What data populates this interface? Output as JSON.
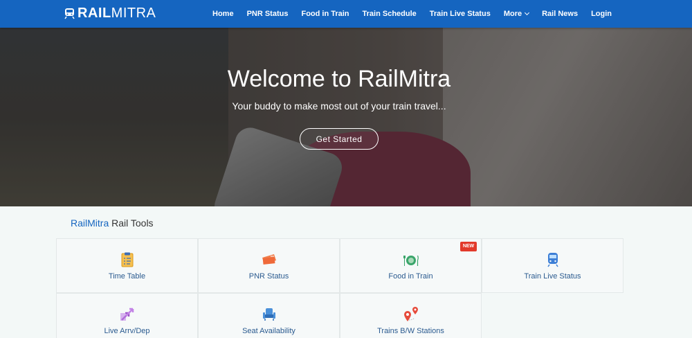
{
  "brand": {
    "bold": "RAIL",
    "light": "MITRA"
  },
  "nav": {
    "items": [
      "Home",
      "PNR Status",
      "Food in Train",
      "Train Schedule",
      "Train Live Status",
      "More",
      "Rail News",
      "Login"
    ]
  },
  "hero": {
    "title": "Welcome to RailMitra",
    "subtitle": "Your buddy to make most out of your train travel...",
    "cta": "Get Started"
  },
  "tools": {
    "brand": "RailMitra",
    "rest": " Rail Tools",
    "items": [
      {
        "label": "Time Table",
        "icon": "clipboard-icon"
      },
      {
        "label": "PNR Status",
        "icon": "ticket-icon"
      },
      {
        "label": "Food in Train",
        "icon": "plate-icon",
        "badge": "NEW"
      },
      {
        "label": "Train Live Status",
        "icon": "train-icon"
      },
      {
        "label": "Live Arrv/Dep",
        "icon": "arrows-icon"
      },
      {
        "label": "Seat Availability",
        "icon": "seat-icon"
      },
      {
        "label": "Trains B/W Stations",
        "icon": "map-pin-icon"
      }
    ]
  },
  "colors": {
    "primary": "#1565c0",
    "badge": "#e23a2b"
  }
}
